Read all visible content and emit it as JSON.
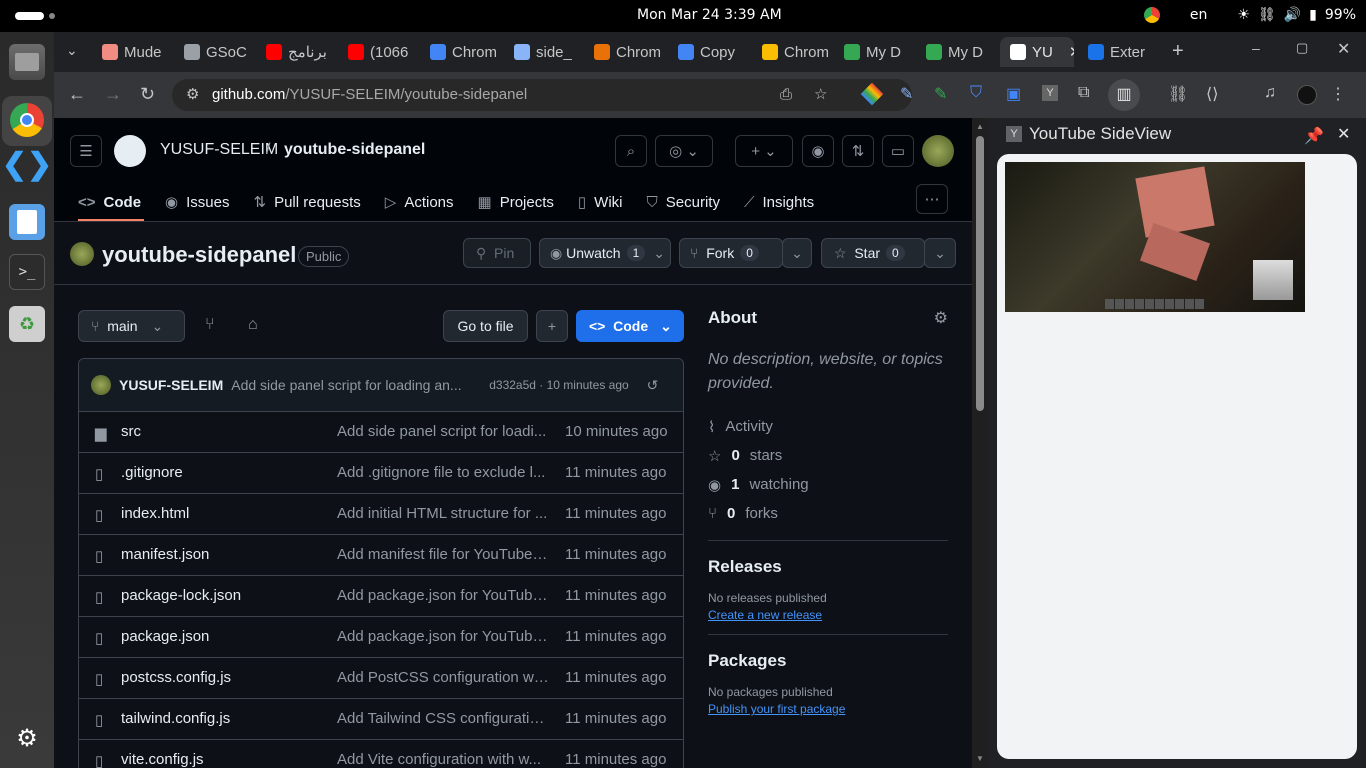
{
  "system": {
    "clock": "Mon Mar 24   3:39 AM",
    "lang": "en",
    "battery": "99%"
  },
  "tabs": [
    {
      "label": "Mude",
      "color": "#f28b82"
    },
    {
      "label": "GSoC",
      "color": "#9aa0a6"
    },
    {
      "label": "برنامج",
      "color": "#ff0000"
    },
    {
      "label": "(1066",
      "color": "#ff0000"
    },
    {
      "label": "Chrom",
      "color": "#4285f4"
    },
    {
      "label": "side_",
      "color": "#8ab4f8"
    },
    {
      "label": "Chrom",
      "color": "#e8710a"
    },
    {
      "label": "Copy",
      "color": "#4285f4"
    },
    {
      "label": "Chrom",
      "color": "#fbbc04"
    },
    {
      "label": "My D",
      "color": "#34a853"
    },
    {
      "label": "My D",
      "color": "#34a853"
    },
    {
      "label": "YU",
      "color": "#ffffff"
    },
    {
      "label": "Exter",
      "color": "#1a73e8"
    }
  ],
  "address": {
    "host": "github.com",
    "path": "/YUSUF-SELEIM/youtube-sidepanel"
  },
  "gh": {
    "owner": "YUSUF-SELEIM",
    "slash": "/",
    "repo": "youtube-sidepanel",
    "nav": [
      "Code",
      "Issues",
      "Pull requests",
      "Actions",
      "Projects",
      "Wiki",
      "Security",
      "Insights"
    ],
    "repo_title": "youtube-sidepanel",
    "visibility": "Public",
    "pin": "Pin",
    "unwatch": "Unwatch",
    "watch_count": "1",
    "fork": "Fork",
    "fork_count": "0",
    "star": "Star",
    "star_count": "0",
    "branch": "main",
    "go_to_file": "Go to file",
    "plus": "+",
    "code_btn": "Code",
    "commit": {
      "author": "YUSUF-SELEIM",
      "message": "Add side panel script for loading an...",
      "meta": "d332a5d · 10 minutes ago"
    },
    "files": [
      {
        "name": "src",
        "msg": "Add side panel script for loadi...",
        "time": "10 minutes ago",
        "type": "dir"
      },
      {
        "name": ".gitignore",
        "msg": "Add .gitignore file to exclude l...",
        "time": "11 minutes ago",
        "type": "file"
      },
      {
        "name": "index.html",
        "msg": "Add initial HTML structure for ...",
        "time": "11 minutes ago",
        "type": "file"
      },
      {
        "name": "manifest.json",
        "msg": "Add manifest file for YouTube ...",
        "time": "11 minutes ago",
        "type": "file"
      },
      {
        "name": "package-lock.json",
        "msg": "Add package.json for YouTube...",
        "time": "11 minutes ago",
        "type": "file"
      },
      {
        "name": "package.json",
        "msg": "Add package.json for YouTube...",
        "time": "11 minutes ago",
        "type": "file"
      },
      {
        "name": "postcss.config.js",
        "msg": "Add PostCSS configuration wit...",
        "time": "11 minutes ago",
        "type": "file"
      },
      {
        "name": "tailwind.config.js",
        "msg": "Add Tailwind CSS configuratio...",
        "time": "11 minutes ago",
        "type": "file"
      },
      {
        "name": "vite.config.js",
        "msg": "Add Vite configuration with w...",
        "time": "11 minutes ago",
        "type": "file"
      }
    ],
    "about": {
      "title": "About",
      "desc": "No description, website, or topics provided.",
      "activity": "Activity",
      "stars": "0",
      "stars_l": "stars",
      "watching": "1",
      "watching_l": "watching",
      "forks": "0",
      "forks_l": "forks"
    },
    "releases": {
      "title": "Releases",
      "none": "No releases published",
      "link": "Create a new release"
    },
    "packages": {
      "title": "Packages",
      "none": "No packages published",
      "link": "Publish your first package"
    }
  },
  "sidepanel": {
    "title": "YouTube SideView",
    "badge": "Y"
  }
}
